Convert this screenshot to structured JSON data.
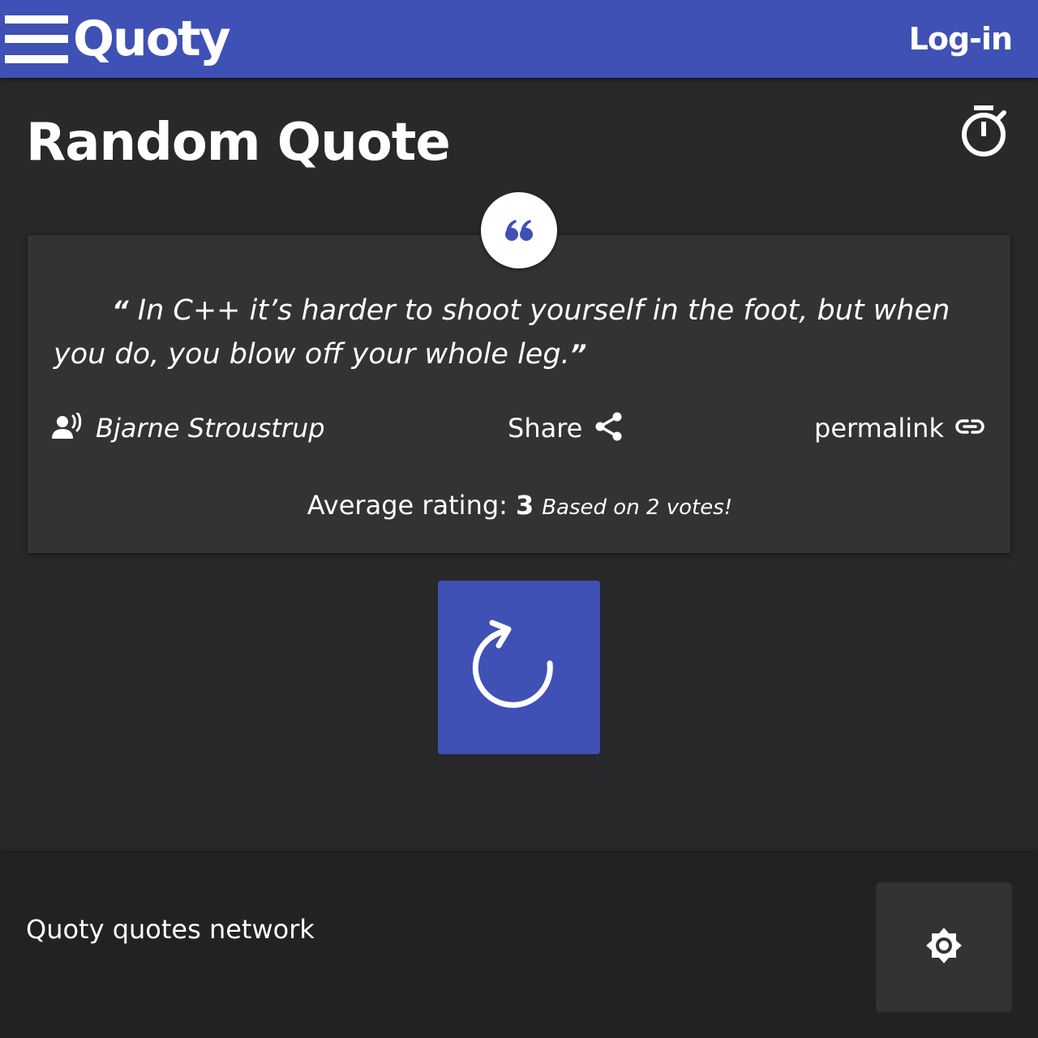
{
  "header": {
    "logo": "Quoty",
    "login_label": "Log-in",
    "menu_icon": "hamburger-menu-icon",
    "background_color": "#3f51b5"
  },
  "main": {
    "title": "Random Quote",
    "timer_icon": "timer-icon"
  },
  "quote": {
    "badge_icon": "format-quote-icon",
    "open_mark": "“",
    "text": "In C++ it’s harder to shoot yourself in the foot, but when you do, you blow off your whole leg.",
    "close_mark": "”",
    "author": "Bjarne Stroustrup",
    "author_icon": "record-voice-icon",
    "share_label": "Share",
    "share_icon": "share-icon",
    "permalink_label": "permalink",
    "permalink_icon": "link-icon",
    "rating_label": "Average rating:",
    "rating_value": "3",
    "rating_votes": "Based on 2 votes!"
  },
  "actions": {
    "refresh_icon": "refresh-icon",
    "refresh_color": "#3f51b5"
  },
  "footer": {
    "text": "Quoty quotes network",
    "theme_icon": "brightness-icon"
  }
}
